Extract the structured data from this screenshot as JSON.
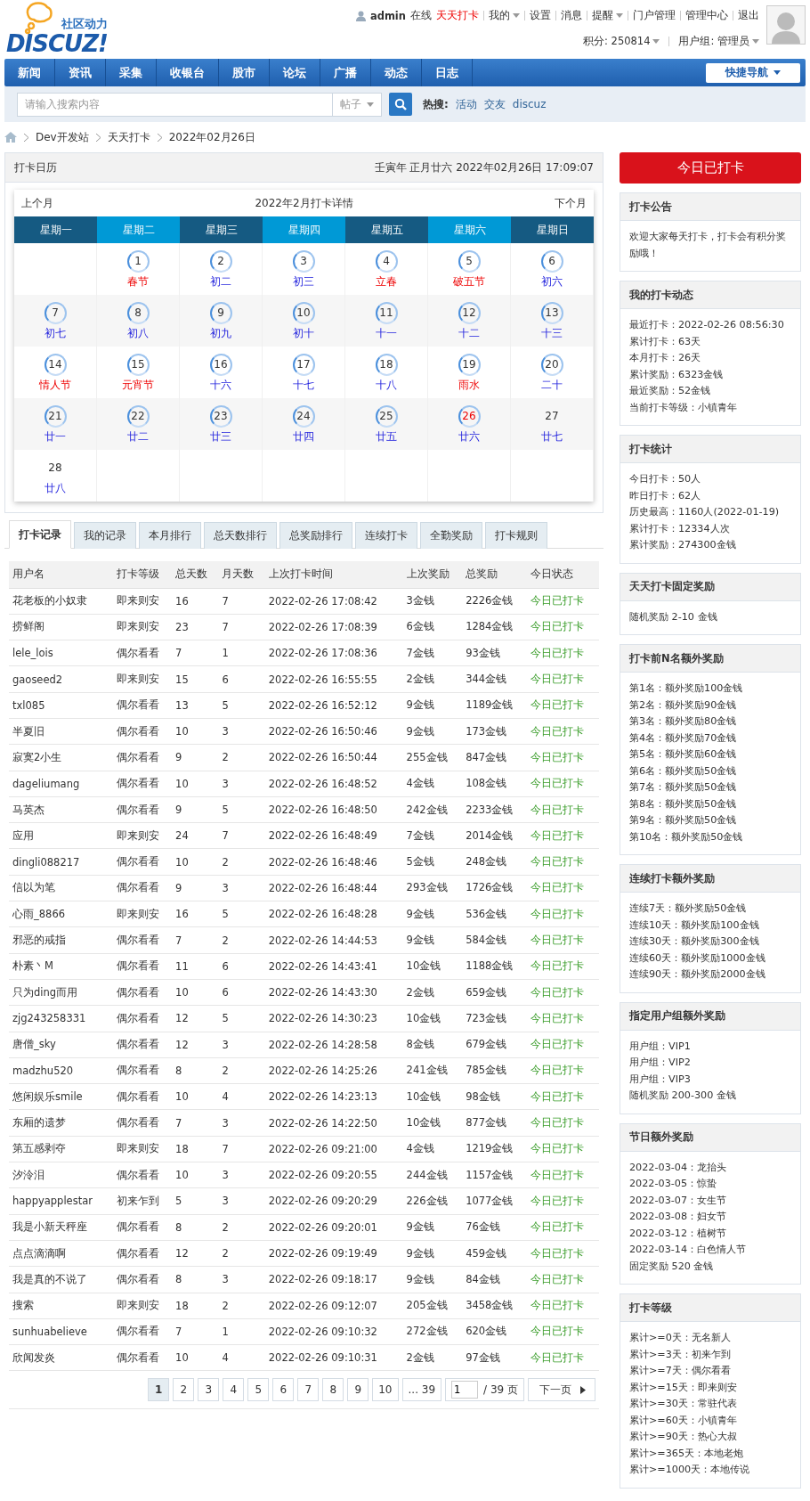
{
  "header": {
    "logo_tagline": "社区动力",
    "logo_name": "DISCUZ!",
    "user": "admin",
    "online": "在线",
    "links": [
      {
        "label": "天天打卡",
        "kind": "highlight"
      },
      {
        "label": "我的",
        "kind": "menu"
      },
      {
        "label": "设置",
        "kind": "plain"
      },
      {
        "label": "消息",
        "kind": "plain"
      },
      {
        "label": "提醒",
        "kind": "menu"
      },
      {
        "label": "门户管理",
        "kind": "plain"
      },
      {
        "label": "管理中心",
        "kind": "plain"
      },
      {
        "label": "退出",
        "kind": "plain"
      }
    ],
    "credits": "积分: 250814",
    "group": "用户组: 管理员"
  },
  "nav": {
    "items": [
      "新闻",
      "资讯",
      "采集",
      "收银台",
      "股市",
      "论坛",
      "广播",
      "动态",
      "日志"
    ],
    "quick": "快捷导航"
  },
  "search": {
    "placeholder": "请输入搜索内容",
    "scope": "帖子",
    "hot_label": "热搜:",
    "hot": [
      "活动",
      "交友",
      "discuz"
    ]
  },
  "breadcrumb": [
    "Dev开发站",
    "天天打卡",
    "2022年02月26日"
  ],
  "calendar": {
    "title": "打卡日历",
    "datetime": "壬寅年 正月廿六 2022年02月26日 17:09:07",
    "prev": "上个月",
    "caption": "2022年2月打卡详情",
    "next": "下个月",
    "weekdays": [
      "星期一",
      "星期二",
      "星期三",
      "星期四",
      "星期五",
      "星期六",
      "星期日"
    ],
    "weeks": [
      [
        {
          "kind": "blank"
        },
        {
          "kind": "day",
          "day": "1",
          "lunar": "春节",
          "festival": true,
          "signed": true,
          "today": false
        },
        {
          "kind": "day",
          "day": "2",
          "lunar": "初二",
          "festival": false,
          "signed": true,
          "today": false
        },
        {
          "kind": "day",
          "day": "3",
          "lunar": "初三",
          "festival": false,
          "signed": true,
          "today": false
        },
        {
          "kind": "day",
          "day": "4",
          "lunar": "立春",
          "festival": true,
          "signed": true,
          "today": false
        },
        {
          "kind": "day",
          "day": "5",
          "lunar": "破五节",
          "festival": true,
          "signed": true,
          "today": false
        },
        {
          "kind": "day",
          "day": "6",
          "lunar": "初六",
          "festival": false,
          "signed": true,
          "today": false
        }
      ],
      [
        {
          "kind": "day",
          "day": "7",
          "lunar": "初七",
          "festival": false,
          "signed": true,
          "today": false
        },
        {
          "kind": "day",
          "day": "8",
          "lunar": "初八",
          "festival": false,
          "signed": true,
          "today": false
        },
        {
          "kind": "day",
          "day": "9",
          "lunar": "初九",
          "festival": false,
          "signed": true,
          "today": false
        },
        {
          "kind": "day",
          "day": "10",
          "lunar": "初十",
          "festival": false,
          "signed": true,
          "today": false
        },
        {
          "kind": "day",
          "day": "11",
          "lunar": "十一",
          "festival": false,
          "signed": true,
          "today": false
        },
        {
          "kind": "day",
          "day": "12",
          "lunar": "十二",
          "festival": false,
          "signed": true,
          "today": false
        },
        {
          "kind": "day",
          "day": "13",
          "lunar": "十三",
          "festival": false,
          "signed": true,
          "today": false
        }
      ],
      [
        {
          "kind": "day",
          "day": "14",
          "lunar": "情人节",
          "festival": true,
          "signed": true,
          "today": false
        },
        {
          "kind": "day",
          "day": "15",
          "lunar": "元宵节",
          "festival": true,
          "signed": true,
          "today": false
        },
        {
          "kind": "day",
          "day": "16",
          "lunar": "十六",
          "festival": false,
          "signed": true,
          "today": false
        },
        {
          "kind": "day",
          "day": "17",
          "lunar": "十七",
          "festival": false,
          "signed": true,
          "today": false
        },
        {
          "kind": "day",
          "day": "18",
          "lunar": "十八",
          "festival": false,
          "signed": true,
          "today": false
        },
        {
          "kind": "day",
          "day": "19",
          "lunar": "雨水",
          "festival": true,
          "signed": true,
          "today": false
        },
        {
          "kind": "day",
          "day": "20",
          "lunar": "二十",
          "festival": false,
          "signed": true,
          "today": false
        }
      ],
      [
        {
          "kind": "day",
          "day": "21",
          "lunar": "廿一",
          "festival": false,
          "signed": true,
          "today": false
        },
        {
          "kind": "day",
          "day": "22",
          "lunar": "廿二",
          "festival": false,
          "signed": true,
          "today": false
        },
        {
          "kind": "day",
          "day": "23",
          "lunar": "廿三",
          "festival": false,
          "signed": true,
          "today": false
        },
        {
          "kind": "day",
          "day": "24",
          "lunar": "廿四",
          "festival": false,
          "signed": true,
          "today": false
        },
        {
          "kind": "day",
          "day": "25",
          "lunar": "廿五",
          "festival": false,
          "signed": true,
          "today": false
        },
        {
          "kind": "day",
          "day": "26",
          "lunar": "廿六",
          "festival": false,
          "signed": true,
          "today": true
        },
        {
          "kind": "day",
          "day": "27",
          "lunar": "廿七",
          "festival": false,
          "signed": false,
          "today": false
        }
      ],
      [
        {
          "kind": "day",
          "day": "28",
          "lunar": "廿八",
          "festival": false,
          "signed": false,
          "today": false
        },
        {
          "kind": "blank"
        },
        {
          "kind": "blank"
        },
        {
          "kind": "blank"
        },
        {
          "kind": "blank"
        },
        {
          "kind": "blank"
        },
        {
          "kind": "blank"
        }
      ]
    ]
  },
  "tabs": [
    {
      "label": "打卡记录",
      "selected": true
    },
    {
      "label": "我的记录",
      "selected": false
    },
    {
      "label": "本月排行",
      "selected": false
    },
    {
      "label": "总天数排行",
      "selected": false
    },
    {
      "label": "总奖励排行",
      "selected": false
    },
    {
      "label": "连续打卡",
      "selected": false
    },
    {
      "label": "全勤奖励",
      "selected": false
    },
    {
      "label": "打卡规则",
      "selected": false
    }
  ],
  "table": {
    "columns": [
      "用户名",
      "打卡等级",
      "总天数",
      "月天数",
      "上次打卡时间",
      "上次奖励",
      "总奖励",
      "今日状态"
    ],
    "rows": [
      [
        "花老板的小奴隶",
        "即来则安",
        "16",
        "7",
        "2022-02-26 17:08:42",
        "3金钱",
        "2226金钱",
        "今日已打卡"
      ],
      [
        "捞鲜阁",
        "即来则安",
        "23",
        "7",
        "2022-02-26 17:08:39",
        "6金钱",
        "1284金钱",
        "今日已打卡"
      ],
      [
        "lele_lois",
        "偶尔看看",
        "7",
        "1",
        "2022-02-26 17:08:36",
        "7金钱",
        "93金钱",
        "今日已打卡"
      ],
      [
        "gaoseed2",
        "即来则安",
        "15",
        "6",
        "2022-02-26 16:55:55",
        "2金钱",
        "344金钱",
        "今日已打卡"
      ],
      [
        "txl085",
        "偶尔看看",
        "13",
        "5",
        "2022-02-26 16:52:12",
        "9金钱",
        "1189金钱",
        "今日已打卡"
      ],
      [
        "半夏旧",
        "偶尔看看",
        "10",
        "3",
        "2022-02-26 16:50:46",
        "9金钱",
        "173金钱",
        "今日已打卡"
      ],
      [
        "寂寞2小生",
        "偶尔看看",
        "9",
        "2",
        "2022-02-26 16:50:44",
        "255金钱",
        "847金钱",
        "今日已打卡"
      ],
      [
        "dageliumang",
        "偶尔看看",
        "10",
        "3",
        "2022-02-26 16:48:52",
        "4金钱",
        "108金钱",
        "今日已打卡"
      ],
      [
        "马英杰",
        "偶尔看看",
        "9",
        "5",
        "2022-02-26 16:48:50",
        "242金钱",
        "2233金钱",
        "今日已打卡"
      ],
      [
        "应用",
        "即来则安",
        "24",
        "7",
        "2022-02-26 16:48:49",
        "7金钱",
        "2014金钱",
        "今日已打卡"
      ],
      [
        "dingli088217",
        "偶尔看看",
        "10",
        "2",
        "2022-02-26 16:48:46",
        "5金钱",
        "248金钱",
        "今日已打卡"
      ],
      [
        "信以为笔",
        "偶尔看看",
        "9",
        "3",
        "2022-02-26 16:48:44",
        "293金钱",
        "1726金钱",
        "今日已打卡"
      ],
      [
        "心雨_8866",
        "即来则安",
        "16",
        "5",
        "2022-02-26 16:48:28",
        "9金钱",
        "536金钱",
        "今日已打卡"
      ],
      [
        "邪恶的戒指",
        "偶尔看看",
        "7",
        "2",
        "2022-02-26 14:44:53",
        "9金钱",
        "584金钱",
        "今日已打卡"
      ],
      [
        "朴素丶M",
        "偶尔看看",
        "11",
        "6",
        "2022-02-26 14:43:41",
        "10金钱",
        "1188金钱",
        "今日已打卡"
      ],
      [
        "只为ding而用",
        "偶尔看看",
        "10",
        "6",
        "2022-02-26 14:43:30",
        "2金钱",
        "659金钱",
        "今日已打卡"
      ],
      [
        "zjg243258331",
        "偶尔看看",
        "12",
        "5",
        "2022-02-26 14:30:23",
        "10金钱",
        "723金钱",
        "今日已打卡"
      ],
      [
        "唐僧_sky",
        "偶尔看看",
        "12",
        "3",
        "2022-02-26 14:28:58",
        "8金钱",
        "679金钱",
        "今日已打卡"
      ],
      [
        "madzhu520",
        "偶尔看看",
        "8",
        "2",
        "2022-02-26 14:25:26",
        "241金钱",
        "785金钱",
        "今日已打卡"
      ],
      [
        "悠闲娱乐smile",
        "偶尔看看",
        "10",
        "4",
        "2022-02-26 14:23:13",
        "10金钱",
        "98金钱",
        "今日已打卡"
      ],
      [
        "东厢的遗梦",
        "偶尔看看",
        "7",
        "3",
        "2022-02-26 14:22:50",
        "10金钱",
        "877金钱",
        "今日已打卡"
      ],
      [
        "第五感剥夺",
        "即来则安",
        "18",
        "7",
        "2022-02-26 09:21:00",
        "4金钱",
        "1219金钱",
        "今日已打卡"
      ],
      [
        "汐泠泪",
        "偶尔看看",
        "10",
        "3",
        "2022-02-26 09:20:55",
        "244金钱",
        "1157金钱",
        "今日已打卡"
      ],
      [
        "happyapplestar",
        "初来乍到",
        "5",
        "3",
        "2022-02-26 09:20:29",
        "226金钱",
        "1077金钱",
        "今日已打卡"
      ],
      [
        "我是小新天秤座",
        "偶尔看看",
        "8",
        "2",
        "2022-02-26 09:20:01",
        "9金钱",
        "76金钱",
        "今日已打卡"
      ],
      [
        "点点滴滴啊",
        "偶尔看看",
        "12",
        "2",
        "2022-02-26 09:19:49",
        "9金钱",
        "459金钱",
        "今日已打卡"
      ],
      [
        "我是真的不说了",
        "偶尔看看",
        "8",
        "3",
        "2022-02-26 09:18:17",
        "9金钱",
        "84金钱",
        "今日已打卡"
      ],
      [
        "搜索",
        "即来则安",
        "18",
        "2",
        "2022-02-26 09:12:07",
        "205金钱",
        "3458金钱",
        "今日已打卡"
      ],
      [
        "sunhuabelieve",
        "偶尔看看",
        "7",
        "1",
        "2022-02-26 09:10:32",
        "272金钱",
        "620金钱",
        "今日已打卡"
      ],
      [
        "欣闻发炎",
        "偶尔看看",
        "10",
        "4",
        "2022-02-26 09:10:31",
        "2金钱",
        "97金钱",
        "今日已打卡"
      ]
    ]
  },
  "pagination": {
    "pages": [
      {
        "label": "1",
        "selected": true
      },
      {
        "label": "2",
        "selected": false
      },
      {
        "label": "3",
        "selected": false
      },
      {
        "label": "4",
        "selected": false
      },
      {
        "label": "5",
        "selected": false
      },
      {
        "label": "6",
        "selected": false
      },
      {
        "label": "7",
        "selected": false
      },
      {
        "label": "8",
        "selected": false
      },
      {
        "label": "9",
        "selected": false
      },
      {
        "label": "10",
        "selected": false
      },
      {
        "label": "... 39",
        "selected": false
      }
    ],
    "page_input": "1",
    "total": "/ 39 页",
    "next": "下一页"
  },
  "sidebar": {
    "checkin_button": "今日已打卡",
    "panels": [
      {
        "title": "打卡公告",
        "lines": [
          "欢迎大家每天打卡，打卡会有积分奖励哦！"
        ]
      },
      {
        "title": "我的打卡动态",
        "lines": [
          "最近打卡：2022-02-26 08:56:30",
          "累计打卡：63天",
          "本月打卡：26天",
          "累计奖励：6323金钱",
          "最近奖励：52金钱",
          "当前打卡等级：小镇青年"
        ]
      },
      {
        "title": "打卡统计",
        "lines": [
          "今日打卡：50人",
          "昨日打卡：62人",
          "历史最高：1160人(2022-01-19)",
          "累计打卡：12334人次",
          "累计奖励：274300金钱"
        ]
      },
      {
        "title": "天天打卡固定奖励",
        "lines": [
          "随机奖励 2-10 金钱"
        ]
      },
      {
        "title": "打卡前N名额外奖励",
        "lines": [
          "第1名：额外奖励100金钱",
          "第2名：额外奖励90金钱",
          "第3名：额外奖励80金钱",
          "第4名：额外奖励70金钱",
          "第5名：额外奖励60金钱",
          "第6名：额外奖励50金钱",
          "第7名：额外奖励50金钱",
          "第8名：额外奖励50金钱",
          "第9名：额外奖励50金钱",
          "第10名：额外奖励50金钱"
        ]
      },
      {
        "title": "连续打卡额外奖励",
        "lines": [
          "连续7天：额外奖励50金钱",
          "连续10天：额外奖励100金钱",
          "连续30天：额外奖励300金钱",
          "连续60天：额外奖励1000金钱",
          "连续90天：额外奖励2000金钱"
        ]
      },
      {
        "title": "指定用户组额外奖励",
        "lines": [
          "用户组：VIP1",
          "用户组：VIP2",
          "用户组：VIP3",
          "随机奖励 200-300 金钱"
        ]
      },
      {
        "title": "节日额外奖励",
        "lines": [
          "2022-03-04：龙抬头",
          "2022-03-05：惊蛰",
          "2022-03-07：女生节",
          "2022-03-08：妇女节",
          "2022-03-12：植树节",
          "2022-03-14：白色情人节",
          "固定奖励 520 金钱"
        ]
      },
      {
        "title": "打卡等级",
        "lines": [
          "累计>=0天：无名新人",
          "累计>=3天：初来乍到",
          "累计>=7天：偶尔看看",
          "累计>=15天：即来则安",
          "累计>=30天：常驻代表",
          "累计>=60天：小镇青年",
          "累计>=90天：热心大叔",
          "累计>=365天：本地老炮",
          "累计>=1000天：本地传说"
        ]
      }
    ]
  }
}
